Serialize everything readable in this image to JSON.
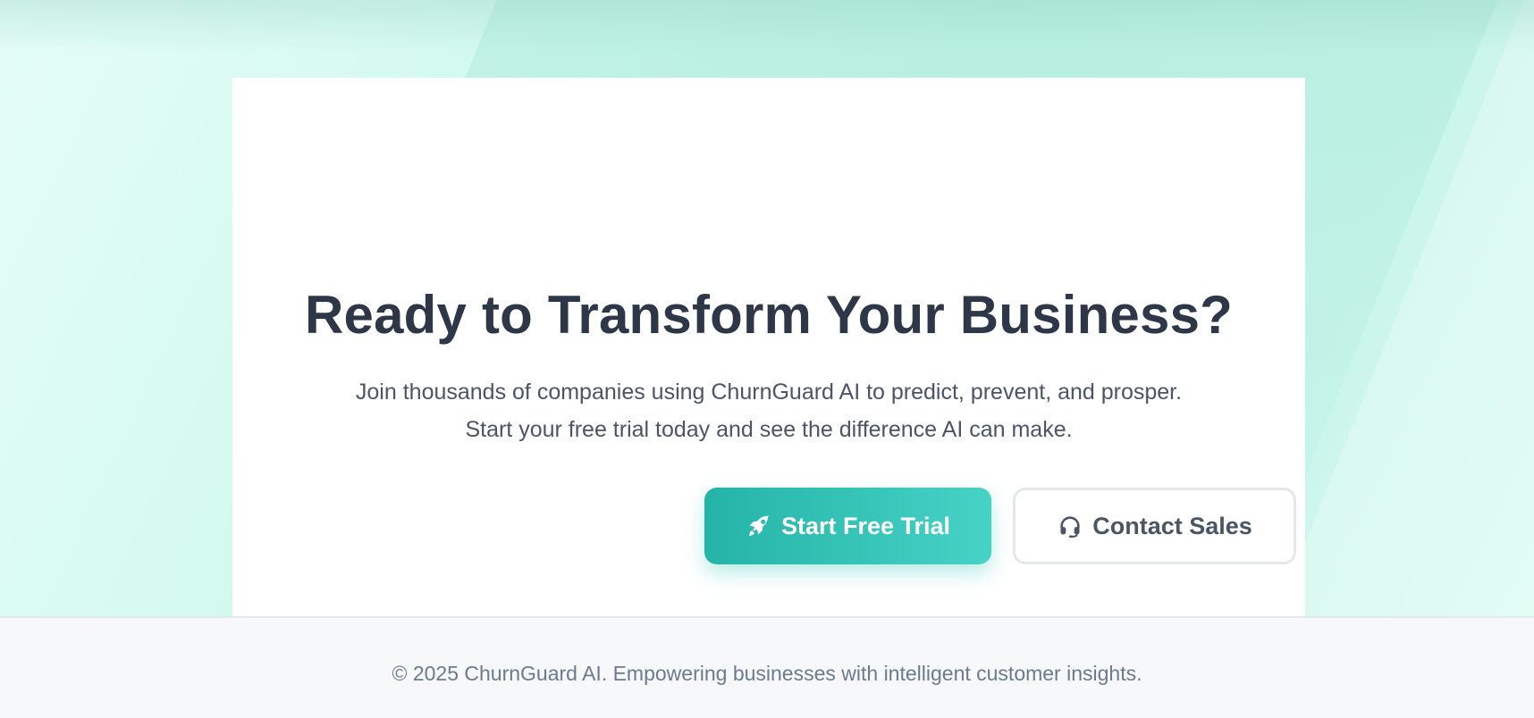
{
  "cta": {
    "title": "Ready to Transform Your Business?",
    "subtitle_line1": "Join thousands of companies using ChurnGuard AI to predict, prevent, and prosper.",
    "subtitle_line2": "Start your free trial today and see the difference AI can make.",
    "primary_button": {
      "label": "Start Free Trial",
      "icon": "rocket-icon",
      "color_start": "#24b4a7",
      "color_end": "#47d2c6"
    },
    "secondary_button": {
      "label": "Contact Sales",
      "icon": "headset-icon"
    }
  },
  "footer": {
    "text": "© 2025 ChurnGuard AI. Empowering businesses with intelligent customer insights."
  },
  "colors": {
    "heading": "#2d3748",
    "body_text": "#4a5568",
    "footer_text": "#6b7a90",
    "hero_background": "#c9f5ea"
  }
}
